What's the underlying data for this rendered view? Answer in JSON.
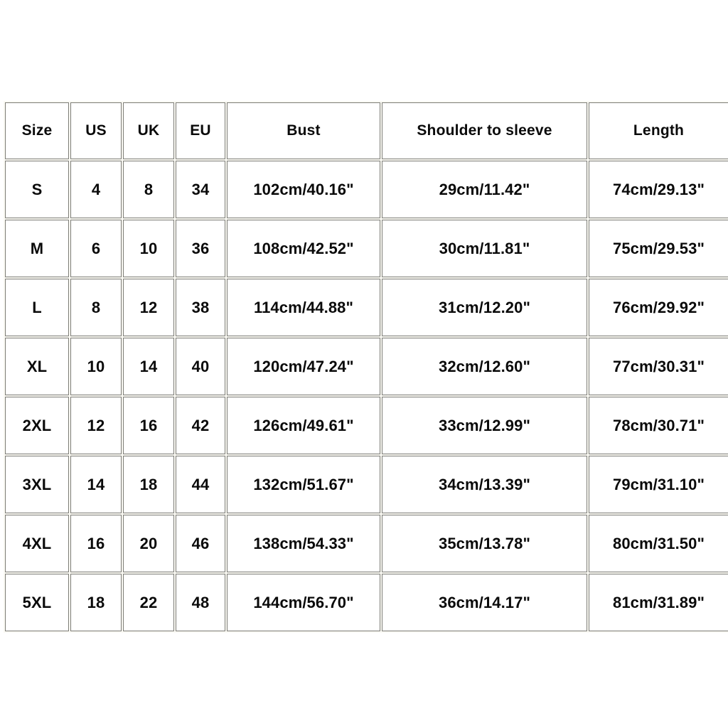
{
  "colors": {
    "page_background": "#ffffff",
    "cell_background": "#ffffff",
    "cell_border": "#7c7c76",
    "gap_tint": "#fbfaf4",
    "text": "#0a0a0a"
  },
  "table": {
    "columns": [
      {
        "key": "size",
        "label": "Size"
      },
      {
        "key": "us",
        "label": "US"
      },
      {
        "key": "uk",
        "label": "UK"
      },
      {
        "key": "eu",
        "label": "EU"
      },
      {
        "key": "bust",
        "label": "Bust"
      },
      {
        "key": "shoulder",
        "label": "Shoulder to sleeve"
      },
      {
        "key": "length",
        "label": "Length"
      }
    ],
    "rows": [
      {
        "size": "S",
        "us": "4",
        "uk": "8",
        "eu": "34",
        "bust": "102cm/40.16\"",
        "shoulder": "29cm/11.42\"",
        "length": "74cm/29.13\""
      },
      {
        "size": "M",
        "us": "6",
        "uk": "10",
        "eu": "36",
        "bust": "108cm/42.52\"",
        "shoulder": "30cm/11.81\"",
        "length": "75cm/29.53\""
      },
      {
        "size": "L",
        "us": "8",
        "uk": "12",
        "eu": "38",
        "bust": "114cm/44.88\"",
        "shoulder": "31cm/12.20\"",
        "length": "76cm/29.92\""
      },
      {
        "size": "XL",
        "us": "10",
        "uk": "14",
        "eu": "40",
        "bust": "120cm/47.24\"",
        "shoulder": "32cm/12.60\"",
        "length": "77cm/30.31\""
      },
      {
        "size": "2XL",
        "us": "12",
        "uk": "16",
        "eu": "42",
        "bust": "126cm/49.61\"",
        "shoulder": "33cm/12.99\"",
        "length": "78cm/30.71\""
      },
      {
        "size": "3XL",
        "us": "14",
        "uk": "18",
        "eu": "44",
        "bust": "132cm/51.67\"",
        "shoulder": "34cm/13.39\"",
        "length": "79cm/31.10\""
      },
      {
        "size": "4XL",
        "us": "16",
        "uk": "20",
        "eu": "46",
        "bust": "138cm/54.33\"",
        "shoulder": "35cm/13.78\"",
        "length": "80cm/31.50\""
      },
      {
        "size": "5XL",
        "us": "18",
        "uk": "22",
        "eu": "48",
        "bust": "144cm/56.70\"",
        "shoulder": "36cm/14.17\"",
        "length": "81cm/31.89\""
      }
    ]
  }
}
